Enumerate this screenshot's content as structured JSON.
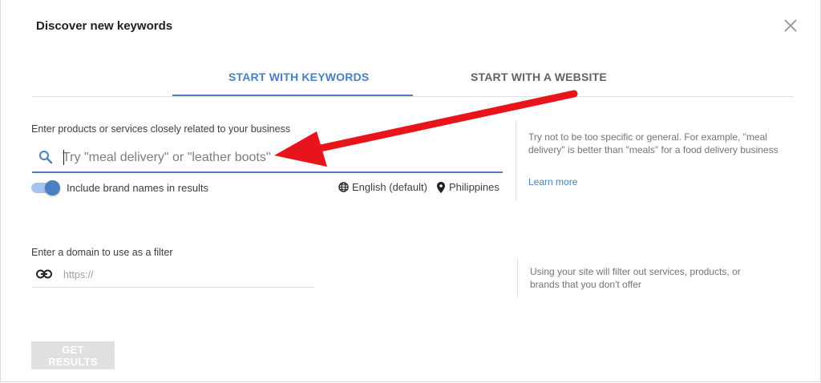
{
  "dialog": {
    "title": "Discover new keywords"
  },
  "tabs": [
    {
      "label": "START WITH KEYWORDS",
      "active": true
    },
    {
      "label": "START WITH A WEBSITE",
      "active": false
    }
  ],
  "keywords": {
    "label": "Enter products or services closely related to your business",
    "placeholder": "Try \"meal delivery\" or \"leather boots\"",
    "value": "",
    "toggle": {
      "label": "Include brand names in results",
      "on": true
    },
    "language": "English (default)",
    "location": "Philippines",
    "hint": "Try not to be too specific or general. For example, \"meal delivery\" is better than \"meals\" for a food delivery business",
    "learn_more": "Learn more"
  },
  "domain": {
    "label": "Enter a domain to use as a filter",
    "placeholder": "https://",
    "value": "",
    "hint": "Using your site will filter out services, products, or brands that you don't offer"
  },
  "actions": {
    "get_results": "GET RESULTS",
    "get_results_enabled": false
  },
  "colors": {
    "accent": "#4a7fc1",
    "annotation_arrow": "#e8141b",
    "disabled_button": "#e0e0e0"
  },
  "icons": {
    "close": "close-icon",
    "search": "search-icon",
    "language": "globe-icon",
    "location": "location-pin-icon",
    "link": "link-icon"
  }
}
